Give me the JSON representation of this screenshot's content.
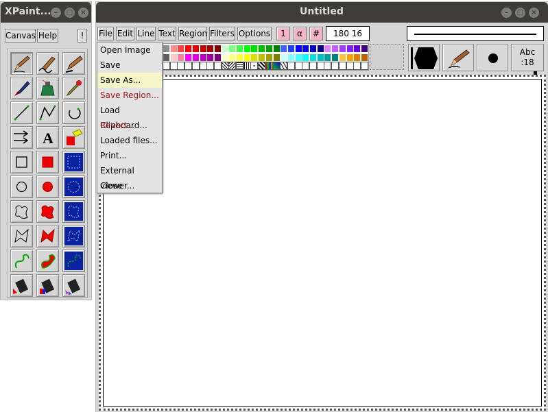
{
  "toolbox": {
    "title": "XPaint...",
    "menu": {
      "canvas": "Canvas",
      "help": "Help",
      "info": "!"
    }
  },
  "canvas_window": {
    "title": "Untitled",
    "menubar": [
      "File",
      "Edit",
      "Line",
      "Text",
      "Region",
      "Filters",
      "Options"
    ],
    "quick_buttons": [
      "1",
      "α",
      "#"
    ],
    "coords": "180 16",
    "font_button": {
      "line1": "Abc",
      "line2": ":18"
    }
  },
  "file_menu": {
    "items": [
      {
        "label": "Open Image",
        "state": "normal"
      },
      {
        "label": "Save",
        "state": "normal"
      },
      {
        "label": "Save As...",
        "state": "highlighted"
      },
      {
        "label": "Save Region...",
        "state": "disabled"
      },
      {
        "label": "Load Clipboard...",
        "state": "normal"
      },
      {
        "label": "Revert...",
        "state": "disabled"
      },
      {
        "label": "Loaded files...",
        "state": "normal"
      },
      {
        "label": "Print...",
        "state": "normal"
      },
      {
        "label": "External viewer...",
        "state": "normal"
      },
      {
        "label": "Close",
        "state": "normal"
      }
    ]
  },
  "tools": [
    "pencil-icon",
    "calligraphy-pen-icon",
    "fountain-pen-icon",
    "brush-icon",
    "sprayer-icon",
    "dropper-icon",
    "line-icon",
    "polyline-icon",
    "arc-icon",
    "arrow-icon",
    "text-icon",
    "erase-icon",
    "rectangle-icon",
    "filled-rectangle-icon",
    "rectangle-select-icon",
    "circle-icon",
    "filled-circle-icon",
    "circle-select-icon",
    "freehand-shape-icon",
    "filled-freehand-icon",
    "freehand-select-icon",
    "polygon-icon",
    "filled-polygon-icon",
    "polygon-select-icon",
    "curve-icon",
    "filled-curve-icon",
    "curve-select-icon",
    "fill-bucket-icon",
    "gradient-fill-icon",
    "fractal-fill-icon"
  ],
  "colors": {
    "titlebar": "#3e3d39",
    "panel": "#d6d6d6",
    "highlight": "#f4f6c8",
    "disabled_text": "#a01818",
    "palette_row1": [
      "#8c8c8c",
      "#ff8c8c",
      "#ff4040",
      "#ff0000",
      "#e00000",
      "#c00000",
      "#a00000",
      "#800000",
      "#c8ffc8",
      "#80ff80",
      "#40ff40",
      "#00ff00",
      "#00e000",
      "#00c000",
      "#00a000",
      "#008000",
      "#4060ff",
      "#2040ff",
      "#0000ff",
      "#0000e0",
      "#0000c0",
      "#000080",
      "#e080ff",
      "#c060ff",
      "#a040ff",
      "#8020ff",
      "#6000e0",
      "#400080"
    ],
    "palette_row2": [
      "#606060",
      "#ffc8c8",
      "#ff80a0",
      "#ff00ff",
      "#e000e0",
      "#c000c0",
      "#a000a0",
      "#800080",
      "#ffffc8",
      "#ffff80",
      "#ffff40",
      "#ffff00",
      "#e0e000",
      "#c0c000",
      "#a0a000",
      "#808000",
      "#c8ffff",
      "#80ffff",
      "#40ffff",
      "#00ffff",
      "#00e0e0",
      "#00c0c0",
      "#00a0a0",
      "#008080",
      "#ffc040",
      "#ffa000",
      "#e08000",
      "#c06000"
    ]
  }
}
